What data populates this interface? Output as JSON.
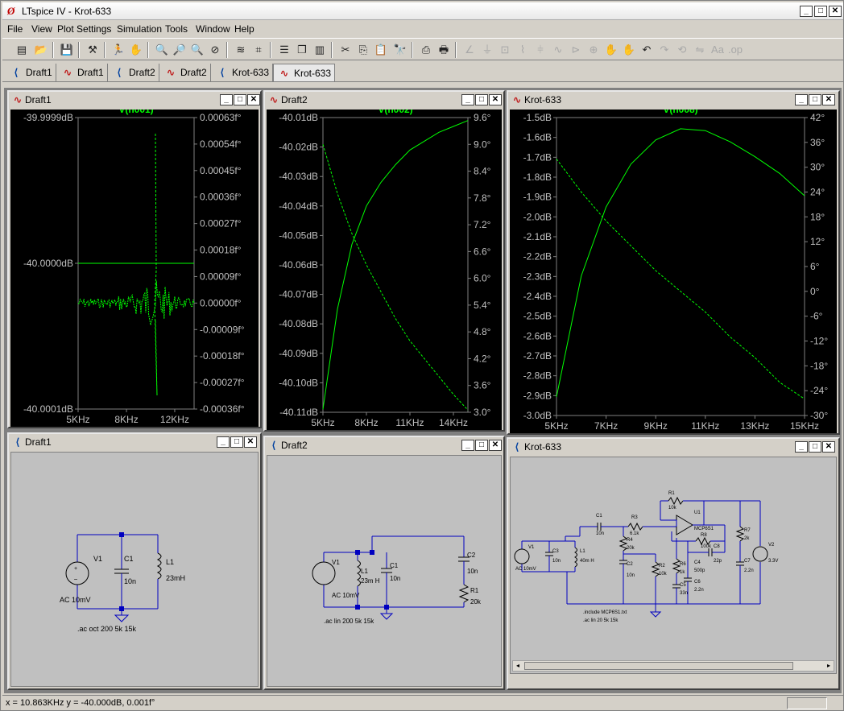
{
  "app": {
    "title": "LTspice IV - Krot-633",
    "icon": "ltspice-logo-icon"
  },
  "menu": {
    "items": [
      "File",
      "View",
      "Plot Settings",
      "Simulation",
      "Tools",
      "Window",
      "Help"
    ]
  },
  "tabs": [
    {
      "label": "Draft1",
      "kind": "schematic"
    },
    {
      "label": "Draft1",
      "kind": "plot"
    },
    {
      "label": "Draft2",
      "kind": "schematic"
    },
    {
      "label": "Draft2",
      "kind": "plot"
    },
    {
      "label": "Krot-633",
      "kind": "schematic"
    },
    {
      "label": "Krot-633",
      "kind": "plot",
      "active": true
    }
  ],
  "windows": {
    "plot1": {
      "title": "Draft1"
    },
    "plot2": {
      "title": "Draft2"
    },
    "plot3": {
      "title": "Krot-633"
    },
    "sch1": {
      "title": "Draft1"
    },
    "sch2": {
      "title": "Draft2"
    },
    "sch3": {
      "title": "Krot-633"
    }
  },
  "chart_data": [
    {
      "type": "line",
      "title": "V(n001)",
      "x_ticks": [
        "5KHz",
        "8KHz",
        "12KHz"
      ],
      "left_ticks": [
        "-39.9999dB",
        "-40.0000dB",
        "-40.0001dB"
      ],
      "right_ticks": [
        "0.00063f°",
        "0.00054f°",
        "0.00045f°",
        "0.00036f°",
        "0.00027f°",
        "0.00018f°",
        "0.00009f°",
        "0.00000f°",
        "-0.00009f°",
        "-0.00018f°",
        "-0.00027f°",
        "-0.00036f°"
      ],
      "series": [
        {
          "style": "solid",
          "desc": "magnitude constant -40.0000dB"
        },
        {
          "style": "dashed",
          "desc": "phase noise around 0 with spike near 10.8KHz"
        }
      ]
    },
    {
      "type": "line",
      "title": "V(n002)",
      "x_ticks": [
        "5KHz",
        "8KHz",
        "11KHz",
        "14KHz"
      ],
      "left_ticks": [
        "-40.01dB",
        "-40.02dB",
        "-40.03dB",
        "-40.04dB",
        "-40.05dB",
        "-40.06dB",
        "-40.07dB",
        "-40.08dB",
        "-40.09dB",
        "-40.10dB",
        "-40.11dB"
      ],
      "right_ticks": [
        "9.6°",
        "9.0°",
        "8.4°",
        "7.8°",
        "7.2°",
        "6.6°",
        "6.0°",
        "5.4°",
        "4.8°",
        "4.2°",
        "3.6°",
        "3.0°"
      ],
      "x": [
        5,
        6,
        7,
        8,
        9,
        10,
        11,
        12,
        13,
        14,
        15
      ],
      "mag": [
        -40.109,
        -40.075,
        -40.053,
        -40.04,
        -40.032,
        -40.026,
        -40.021,
        -40.018,
        -40.015,
        -40.013,
        -40.011
      ],
      "phase": [
        9.0,
        7.9,
        7.0,
        6.3,
        5.7,
        5.1,
        4.6,
        4.2,
        3.8,
        3.4,
        3.05
      ]
    },
    {
      "type": "line",
      "title": "V(n008)",
      "x_ticks": [
        "5KHz",
        "7KHz",
        "9KHz",
        "11KHz",
        "13KHz",
        "15KHz"
      ],
      "left_ticks": [
        "-1.5dB",
        "-1.6dB",
        "-1.7dB",
        "-1.8dB",
        "-1.9dB",
        "-2.0dB",
        "-2.1dB",
        "-2.2dB",
        "-2.3dB",
        "-2.4dB",
        "-2.5dB",
        "-2.6dB",
        "-2.7dB",
        "-2.8dB",
        "-2.9dB",
        "-3.0dB"
      ],
      "right_ticks": [
        "42°",
        "36°",
        "30°",
        "24°",
        "18°",
        "12°",
        "6°",
        "0°",
        "-6°",
        "-12°",
        "-18°",
        "-24°",
        "-30°"
      ],
      "x": [
        5,
        6,
        7,
        8,
        9,
        10,
        11,
        12,
        13,
        14,
        15
      ],
      "mag": [
        -2.9,
        -2.25,
        -1.88,
        -1.65,
        -1.52,
        -1.46,
        -1.47,
        -1.53,
        -1.61,
        -1.7,
        -1.82
      ],
      "phase": [
        32,
        24,
        17,
        11,
        5,
        0,
        -5,
        -11,
        -16,
        -22,
        -26
      ]
    }
  ],
  "schematics": {
    "sch1": {
      "labels": {
        "v1": "V1",
        "ac": "AC 10mV",
        "c1": "C1",
        "c1v": "10n",
        "l1": "L1",
        "l1v": "23mH",
        "cmd": ".ac oct 200 5k 15k"
      }
    },
    "sch2": {
      "labels": {
        "v1": "V1",
        "ac": "AC 10mV",
        "l1": "L1",
        "l1v": "23m H",
        "c1": "C1",
        "c1v": "10n",
        "c2": "C2",
        "c2v": "10n",
        "r1": "R1",
        "r1v": "20k",
        "cmd": ".ac lin 200 5k 15k"
      }
    },
    "sch3": {
      "labels": {
        "v1": "V1",
        "ac": "AC 10mV",
        "c3": "C3",
        "c3v": "10n",
        "l1": "L1",
        "l1v": "40m H",
        "c1": "C1",
        "c1v": "10n",
        "r3": "R3",
        "r3v": "6.1k",
        "r1": "R1",
        "r1v": "10k",
        "u1": "U1",
        "u1v": "MCP6S1",
        "r4": "R4",
        "r4v": "20k",
        "c2": "C2",
        "c2v": "10n",
        "r2": "R2",
        "r2v": "10k",
        "r6": "R6",
        "r6v": "1k",
        "r8": "R8",
        "r8v": "100k",
        "c8": "C8",
        "c8v": "22p",
        "c4": "C4",
        "c4v": "500p",
        "c5": "C5",
        "c5v": "33n",
        "c6": "C6",
        "c6v": "2.2n",
        "r7": "R7",
        "r7v": "2k",
        "c7": "C7",
        "c7v": "2.2n",
        "v2": "V2",
        "v2v": "3.3V",
        "inc": ".include MCP6S1.txt",
        "cmd": ".ac lin 20 5k 15k"
      }
    }
  },
  "status": {
    "text": "x = 10.863KHz    y = -40.000dB, 0.001f°"
  }
}
